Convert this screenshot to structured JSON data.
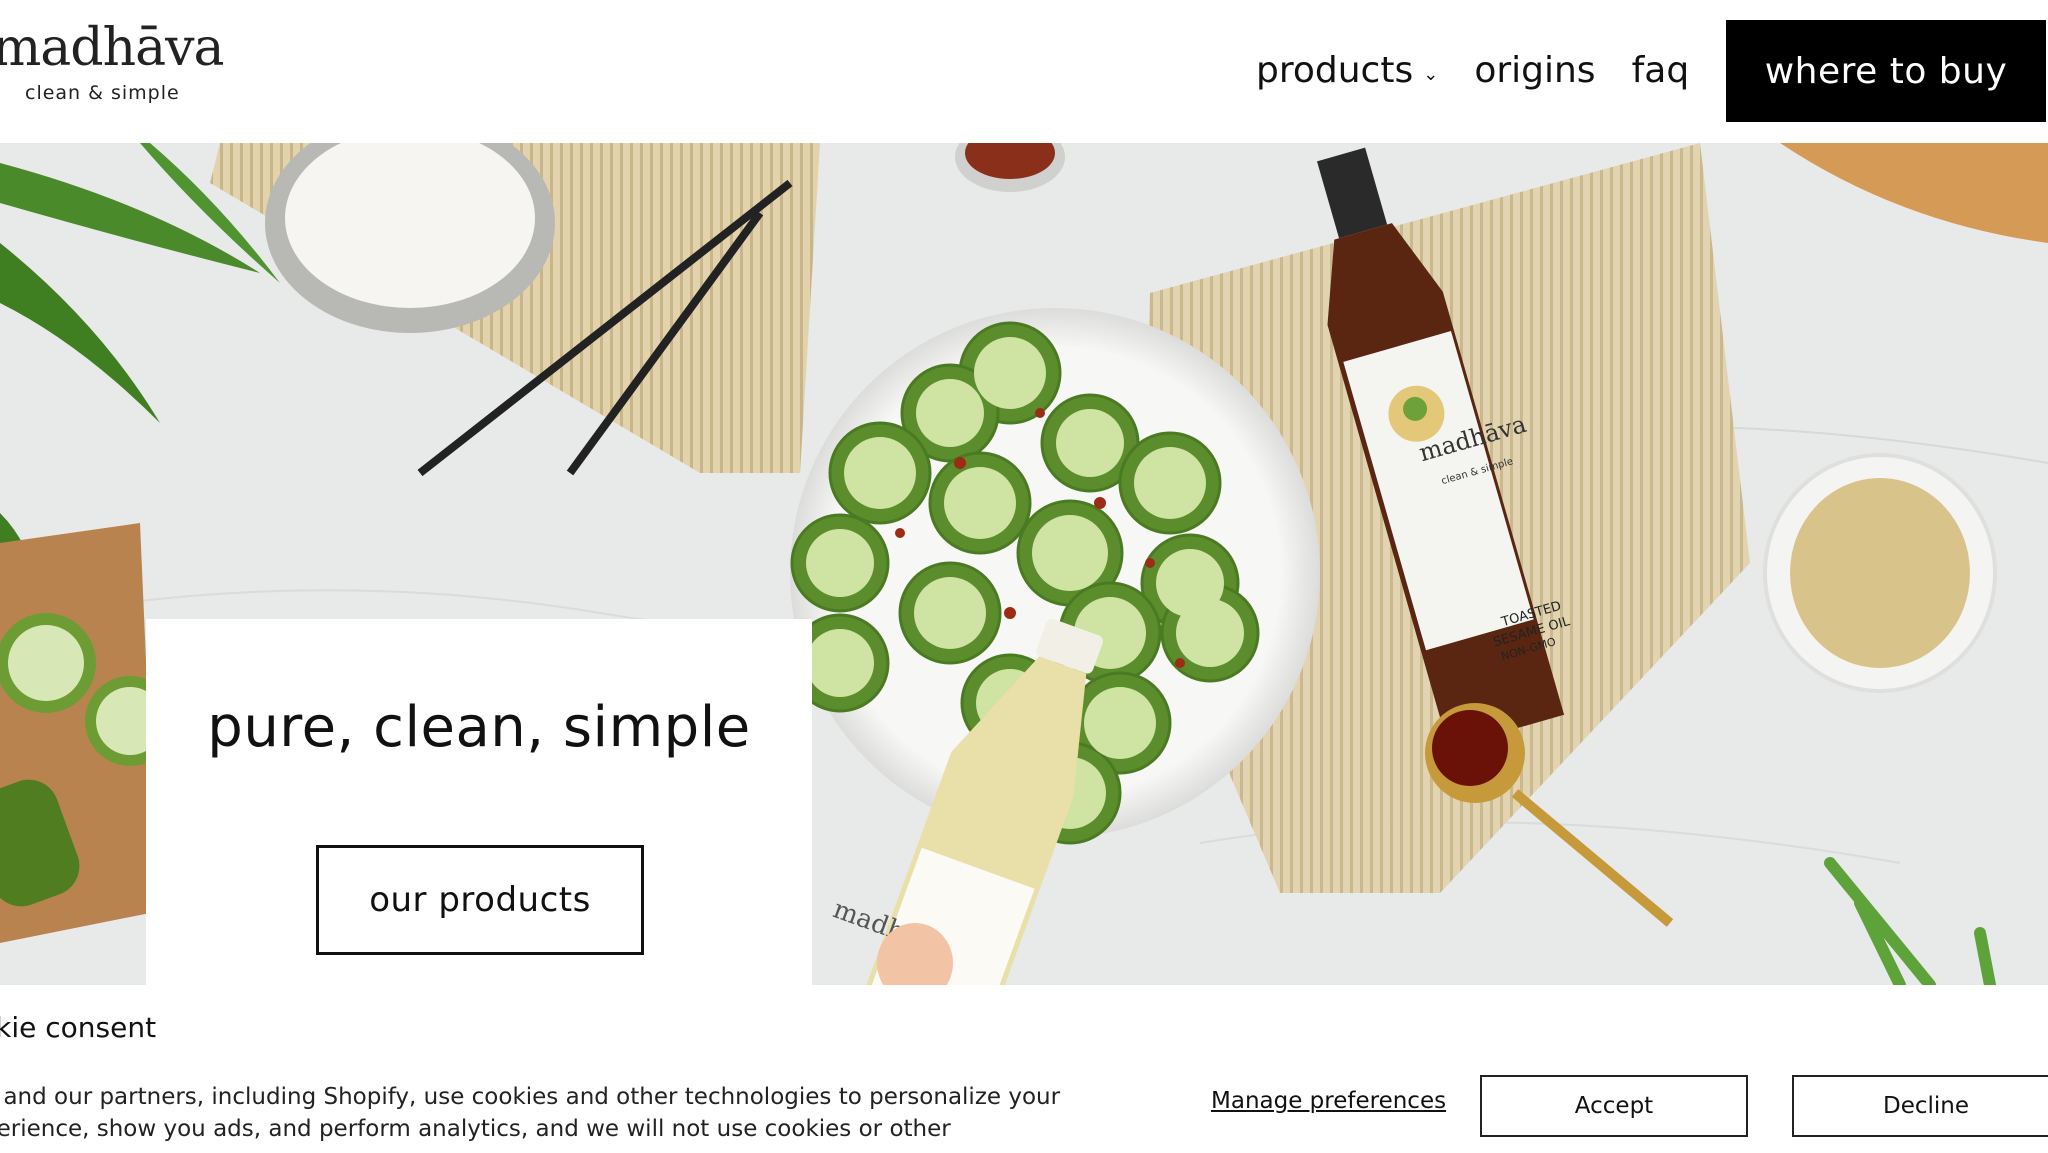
{
  "brand": {
    "name": "madhāva",
    "tagline": "clean & simple"
  },
  "nav": {
    "items": [
      {
        "label": "products",
        "icon": "chevron-down-icon"
      },
      {
        "label": "origins"
      },
      {
        "label": "faq"
      }
    ],
    "cta": "where to buy"
  },
  "hero": {
    "title": "pure, clean, simple",
    "button": "our products",
    "bottle_brand": "madhāva",
    "bottle_tagline": "clean & simple",
    "bottle_label_1": "TOASTED",
    "bottle_label_2": "SESAME OIL",
    "bottle_label_3": "NON-GMO"
  },
  "cookie": {
    "title": "okie consent",
    "text": "e and our partners, including Shopify, use cookies and other technologies to personalize your perience, show you ads, and perform analytics, and we will not use cookies or other",
    "manage": "Manage preferences",
    "accept": "Accept",
    "decline": "Decline"
  },
  "colors": {
    "accent": "#000000",
    "background": "#ffffff",
    "marble": "#e9eaea",
    "bamboo": "#d9c79c",
    "cucumber": "#6d9a3a"
  }
}
